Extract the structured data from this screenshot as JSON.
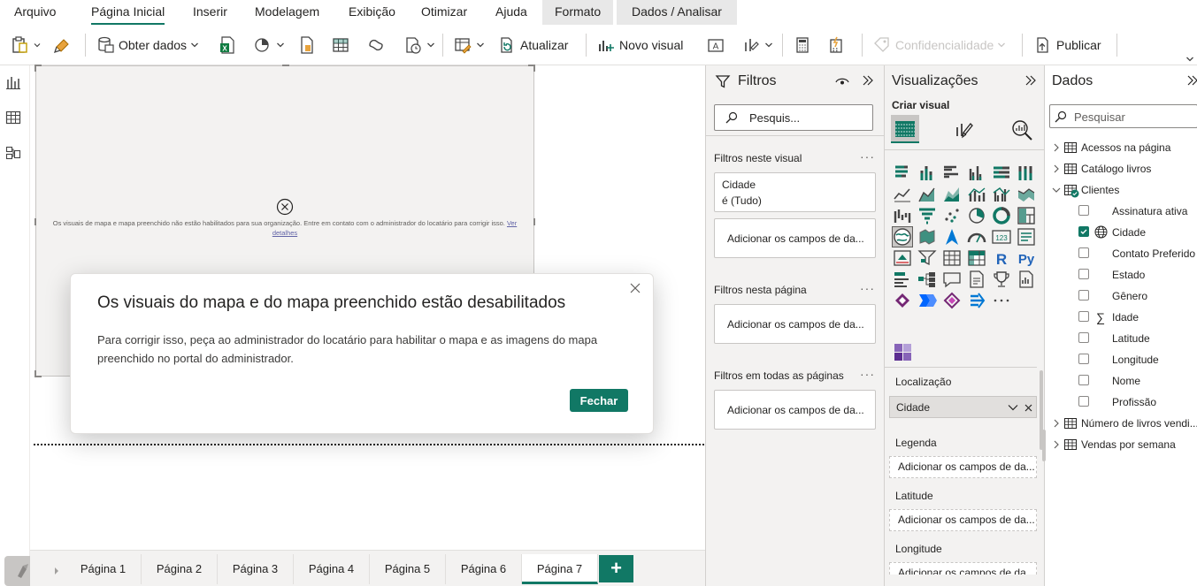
{
  "menu": {
    "items": [
      "Arquivo",
      "Página Inicial",
      "Inserir",
      "Modelagem",
      "Exibição",
      "Otimizar",
      "Ajuda",
      "Formato",
      "Dados / Analisar"
    ],
    "active": "Página Inicial"
  },
  "ribbon": {
    "get_data": "Obter dados",
    "refresh": "Atualizar",
    "new_visual": "Novo visual",
    "sensitivity": "Confidencialidade",
    "publish": "Publicar"
  },
  "map_visual": {
    "message": "Os visuais de mapa e mapa preenchido não estão habilitados para sua organização. Entre em contato com o administrador do locatário para corrigir isso.",
    "link": "Ver detalhes"
  },
  "dialog": {
    "title": "Os visuais do mapa e do mapa preenchido estão desabilitados",
    "body": "Para corrigir isso, peça ao administrador do locatário para habilitar o mapa e as imagens do mapa preenchido no portal do administrador.",
    "close_button": "Fechar"
  },
  "page_tabs": {
    "tabs": [
      "Página 1",
      "Página 2",
      "Página 3",
      "Página 4",
      "Página 5",
      "Página 6",
      "Página 7"
    ],
    "active": "Página 7"
  },
  "filters": {
    "title": "Filtros",
    "search_placeholder": "Pesquis...",
    "on_visual": "Filtros neste visual",
    "filter_card_field": "Cidade",
    "filter_card_value": "é (Tudo)",
    "add_fields": "Adicionar os campos de da...",
    "on_page": "Filtros nesta página",
    "on_all_pages": "Filtros em todas as páginas"
  },
  "visualizations": {
    "title": "Visualizações",
    "build_visual": "Criar visual",
    "location_label": "Localização",
    "location_value": "Cidade",
    "legend_label": "Legenda",
    "latitude_label": "Latitude",
    "longitude_label": "Longitude",
    "add_fields": "Adicionar os campos de da...",
    "more": "..."
  },
  "data_pane": {
    "title": "Dados",
    "search_placeholder": "Pesquisar",
    "tables": [
      {
        "name": "Acessos na página",
        "expanded": false
      },
      {
        "name": "Catálogo livros",
        "expanded": false
      },
      {
        "name": "Clientes",
        "expanded": true
      },
      {
        "name": "Número de livros vendi...",
        "expanded": false
      },
      {
        "name": "Vendas por semana",
        "expanded": false
      }
    ],
    "clientes_fields": [
      {
        "name": "Assinatura ativa",
        "checked": false
      },
      {
        "name": "Cidade",
        "checked": true,
        "icon": "globe-icon"
      },
      {
        "name": "Contato Preferido",
        "checked": false
      },
      {
        "name": "Estado",
        "checked": false
      },
      {
        "name": "Gênero",
        "checked": false
      },
      {
        "name": "Idade",
        "checked": false,
        "icon": "sigma-icon"
      },
      {
        "name": "Latitude",
        "checked": false
      },
      {
        "name": "Longitude",
        "checked": false
      },
      {
        "name": "Nome",
        "checked": false
      },
      {
        "name": "Profissão",
        "checked": false
      }
    ]
  },
  "colors": {
    "accent": "#117865",
    "pane_bg": "#f3f2f1"
  }
}
